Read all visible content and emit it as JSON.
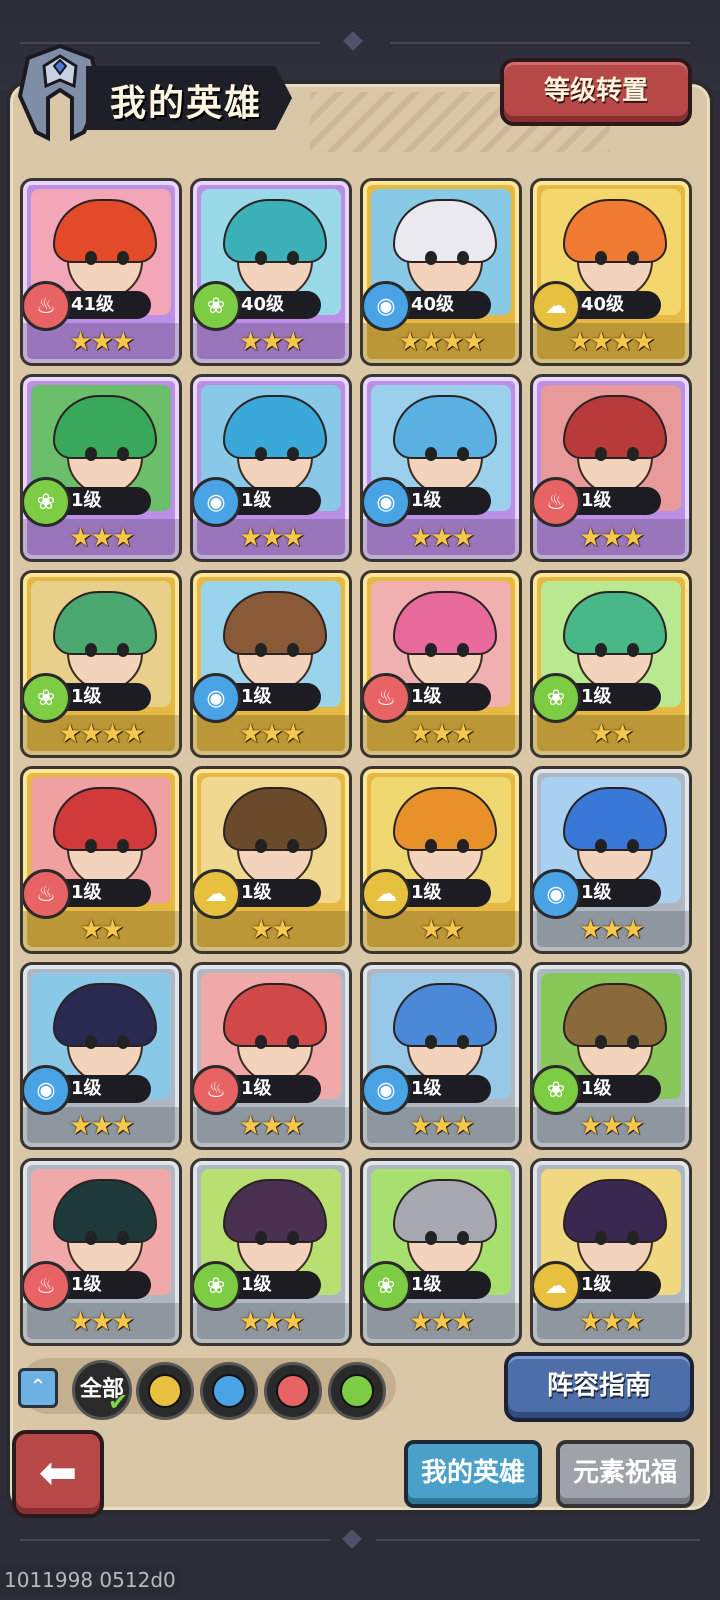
{
  "header": {
    "title": "我的英雄",
    "level_reset_label": "等级转置"
  },
  "heroes": [
    {
      "level": "41级",
      "element": "fire",
      "stars": "★★★",
      "frame": "purple",
      "hair": "#e24a2a",
      "bg": "#f2a6b8"
    },
    {
      "level": "40级",
      "element": "wood",
      "stars": "★★★",
      "frame": "purple",
      "hair": "#3cb0b8",
      "bg": "#9ad9e8"
    },
    {
      "level": "40级",
      "element": "water",
      "stars": "★★★★",
      "frame": "gold",
      "hair": "#e9e9ef",
      "bg": "#88c9e6"
    },
    {
      "level": "40级",
      "element": "earth",
      "stars": "★★★★",
      "frame": "gold",
      "hair": "#f07a32",
      "bg": "#f3d66c"
    },
    {
      "level": "1级",
      "element": "wood",
      "stars": "★★★",
      "frame": "purple",
      "hair": "#3aa85a",
      "bg": "#6bbf6a"
    },
    {
      "level": "1级",
      "element": "water",
      "stars": "★★★",
      "frame": "purple",
      "hair": "#3aa8d8",
      "bg": "#8ac8e8"
    },
    {
      "level": "1级",
      "element": "water",
      "stars": "★★★",
      "frame": "purple",
      "hair": "#5ab0e0",
      "bg": "#9ad0ec"
    },
    {
      "level": "1级",
      "element": "fire",
      "stars": "★★★",
      "frame": "purple",
      "hair": "#b83a3a",
      "bg": "#e89a9a"
    },
    {
      "level": "1级",
      "element": "wood",
      "stars": "★★★★",
      "frame": "gold",
      "hair": "#4aa870",
      "bg": "#e8d08a"
    },
    {
      "level": "1级",
      "element": "water",
      "stars": "★★★",
      "frame": "gold",
      "hair": "#8a5a38",
      "bg": "#9ad4ec"
    },
    {
      "level": "1级",
      "element": "fire",
      "stars": "★★★",
      "frame": "gold",
      "hair": "#e86a9a",
      "bg": "#f0b0b0"
    },
    {
      "level": "1级",
      "element": "wood",
      "stars": "★★",
      "frame": "gold",
      "hair": "#48b888",
      "bg": "#b8e890"
    },
    {
      "level": "1级",
      "element": "fire",
      "stars": "★★",
      "frame": "gold",
      "hair": "#d03a3a",
      "bg": "#f0a0a0"
    },
    {
      "level": "1级",
      "element": "earth",
      "stars": "★★",
      "frame": "gold",
      "hair": "#6a4a2a",
      "bg": "#f0d890"
    },
    {
      "level": "1级",
      "element": "earth",
      "stars": "★★",
      "frame": "gold",
      "hair": "#e8902a",
      "bg": "#f0d870"
    },
    {
      "level": "1级",
      "element": "water",
      "stars": "★★★",
      "frame": "silver",
      "hair": "#3a78d8",
      "bg": "#a8d0f0"
    },
    {
      "level": "1级",
      "element": "water",
      "stars": "★★★",
      "frame": "silver",
      "hair": "#2a2a50",
      "bg": "#8ac8e8"
    },
    {
      "level": "1级",
      "element": "fire",
      "stars": "★★★",
      "frame": "silver",
      "hair": "#d04848",
      "bg": "#f0a8a8"
    },
    {
      "level": "1级",
      "element": "water",
      "stars": "★★★",
      "frame": "silver",
      "hair": "#4a88d8",
      "bg": "#98c8e8"
    },
    {
      "level": "1级",
      "element": "wood",
      "stars": "★★★",
      "frame": "silver",
      "hair": "#8a6a3a",
      "bg": "#88c858"
    },
    {
      "level": "1级",
      "element": "fire",
      "stars": "★★★",
      "frame": "silver",
      "hair": "#1e3a3a",
      "bg": "#f0a8a8"
    },
    {
      "level": "1级",
      "element": "wood",
      "stars": "★★★",
      "frame": "silver",
      "hair": "#4a3050",
      "bg": "#b8e070"
    },
    {
      "level": "1级",
      "element": "wood",
      "stars": "★★★",
      "frame": "silver",
      "hair": "#a8a8b0",
      "bg": "#a8e070"
    },
    {
      "level": "1级",
      "element": "earth",
      "stars": "★★★",
      "frame": "silver",
      "hair": "#3a2850",
      "bg": "#f0d880"
    }
  ],
  "filters": {
    "all_label": "全部",
    "elements": [
      "earth",
      "water",
      "fire",
      "wood"
    ]
  },
  "lineup_guide_label": "阵容指南",
  "tabs": {
    "my_heroes": "我的英雄",
    "element_blessing": "元素祝福"
  },
  "version": "1011998 0512d0",
  "colors": {
    "fire": "#e86363",
    "water": "#4aa3e4",
    "wood": "#7ccc44",
    "earth": "#e8c040"
  }
}
